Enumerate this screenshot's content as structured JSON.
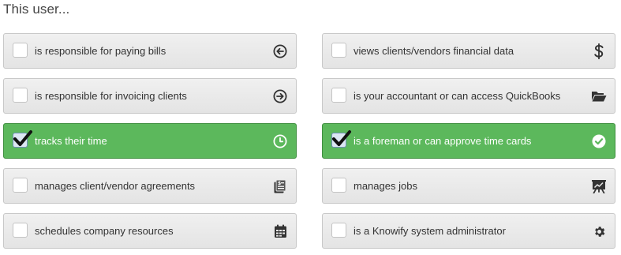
{
  "heading": "This user...",
  "colors": {
    "checked_bg": "#5cb85c",
    "unchecked_bg": "#e9e9e9",
    "icon": "#333333"
  },
  "left_column": [
    {
      "label": "is responsible for paying bills",
      "checked": false,
      "icon": "arrow-circle-left-icon"
    },
    {
      "label": "is responsible for invoicing clients",
      "checked": false,
      "icon": "arrow-circle-right-icon"
    },
    {
      "label": "tracks their time",
      "checked": true,
      "icon": "clock-icon"
    },
    {
      "label": "manages client/vendor agreements",
      "checked": false,
      "icon": "document-dollar-icon"
    },
    {
      "label": "schedules company resources",
      "checked": false,
      "icon": "calendar-icon"
    }
  ],
  "right_column": [
    {
      "label": "views clients/vendors financial data",
      "checked": false,
      "icon": "dollar-icon"
    },
    {
      "label": "is your accountant or can access QuickBooks",
      "checked": false,
      "icon": "folder-open-icon"
    },
    {
      "label": "is a foreman or can approve time cards",
      "checked": true,
      "icon": "check-circle-icon"
    },
    {
      "label": "manages jobs",
      "checked": false,
      "icon": "presentation-chart-icon"
    },
    {
      "label": "is a Knowify system administrator",
      "checked": false,
      "icon": "gear-icon"
    }
  ]
}
